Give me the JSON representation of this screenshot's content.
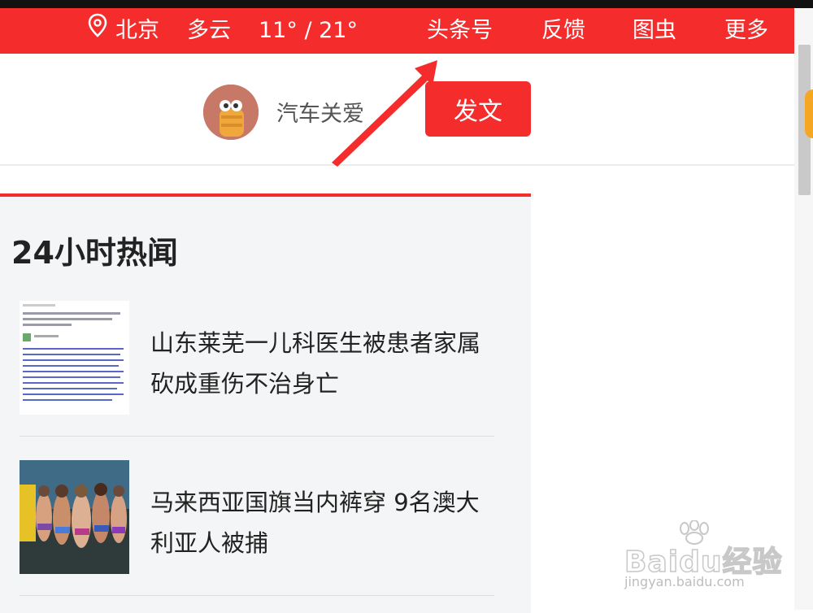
{
  "topbar": {
    "city": "北京",
    "weather": "多云",
    "temp_range": "11° / 21°",
    "links": [
      "头条号",
      "反馈",
      "图虫",
      "更多"
    ]
  },
  "user": {
    "name": "汽车关爱",
    "post_button": "发文"
  },
  "hot_news": {
    "title": "24小时热闻",
    "items": [
      {
        "title": "山东莱芜一儿科医生被患者家属砍成重伤不治身亡"
      },
      {
        "title": "马来西亚国旗当内裤穿 9名澳大利亚人被捕"
      }
    ]
  },
  "watermark": {
    "brand": "Baidu经验",
    "url": "jingyan.baidu.com"
  },
  "colors": {
    "brand_red": "#f42c2c",
    "panel_bg": "#f4f5f6"
  },
  "icons": {
    "location": "location-pin-icon"
  }
}
